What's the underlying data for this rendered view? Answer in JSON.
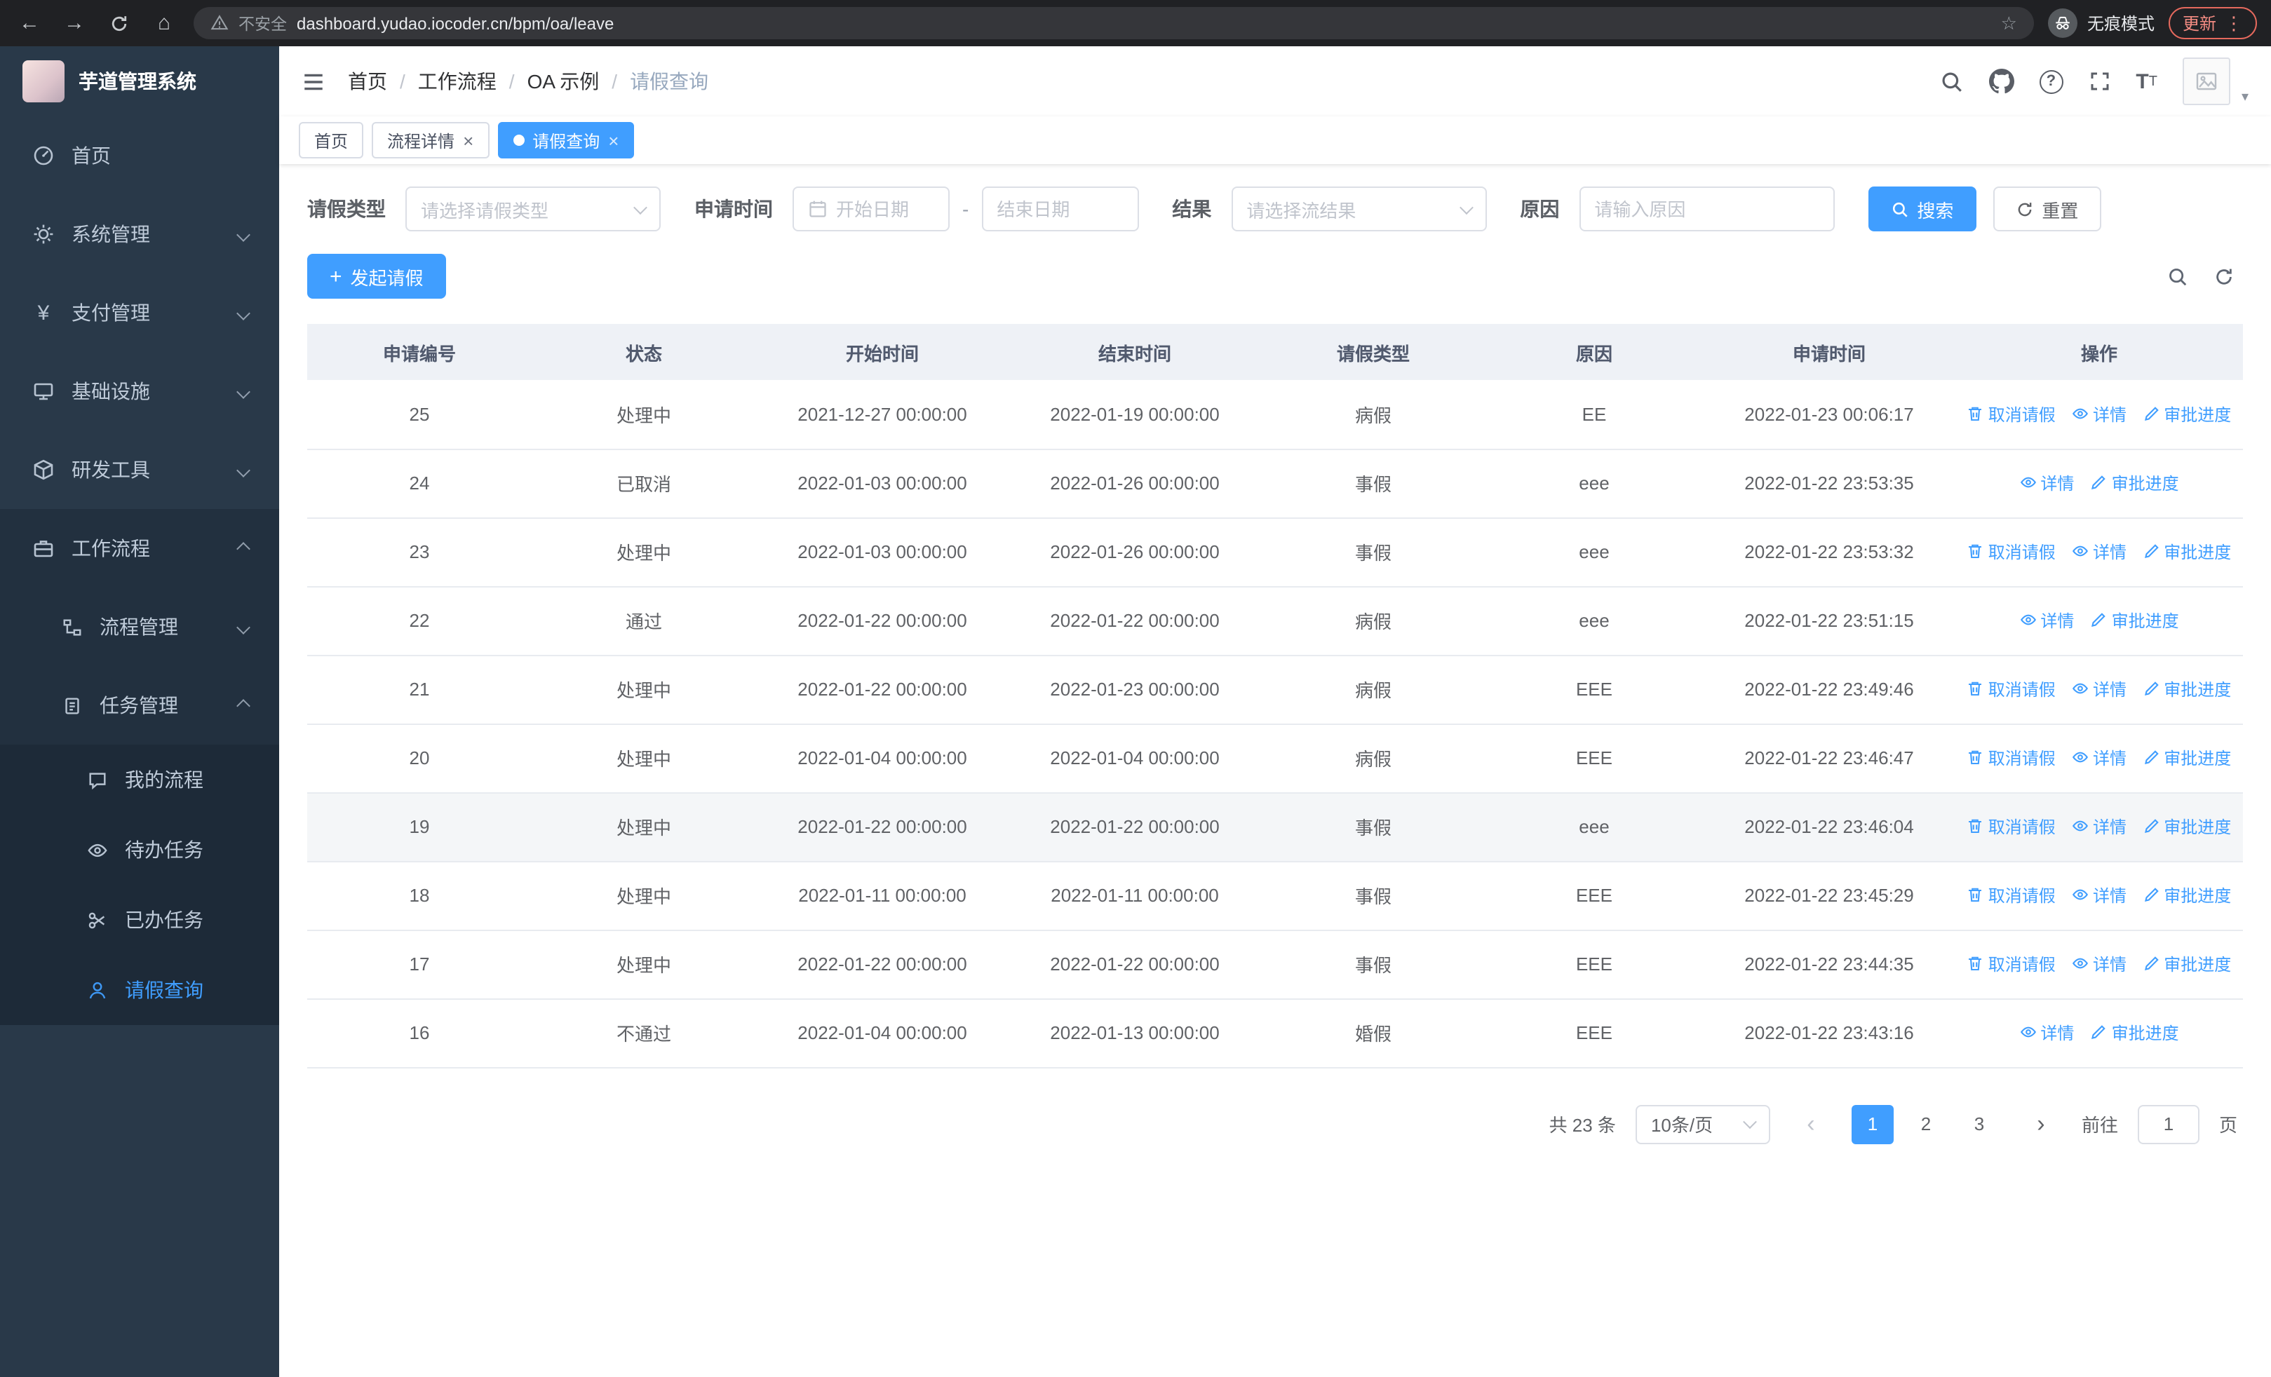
{
  "browser": {
    "security_label": "不安全",
    "url": "dashboard.yudao.iocoder.cn/bpm/oa/leave",
    "incognito_label": "无痕模式",
    "update_label": "更新"
  },
  "sidebar": {
    "app_title": "芋道管理系统",
    "items": [
      {
        "label": "首页"
      },
      {
        "label": "系统管理"
      },
      {
        "label": "支付管理"
      },
      {
        "label": "基础设施"
      },
      {
        "label": "研发工具"
      },
      {
        "label": "工作流程"
      },
      {
        "label": "流程管理"
      },
      {
        "label": "任务管理"
      },
      {
        "label": "我的流程"
      },
      {
        "label": "待办任务"
      },
      {
        "label": "已办任务"
      },
      {
        "label": "请假查询"
      }
    ]
  },
  "breadcrumb": {
    "items": [
      "首页",
      "工作流程",
      "OA 示例",
      "请假查询"
    ]
  },
  "tabs": [
    {
      "label": "首页"
    },
    {
      "label": "流程详情"
    },
    {
      "label": "请假查询"
    }
  ],
  "filters": {
    "type_label": "请假类型",
    "type_placeholder": "请选择请假类型",
    "time_label": "申请时间",
    "start_placeholder": "开始日期",
    "separator": "-",
    "end_placeholder": "结束日期",
    "result_label": "结果",
    "result_placeholder": "请选择流结果",
    "reason_label": "原因",
    "reason_placeholder": "请输入原因",
    "search_label": "搜索",
    "reset_label": "重置"
  },
  "toolbar": {
    "create_label": "发起请假"
  },
  "table": {
    "columns": [
      "申请编号",
      "状态",
      "开始时间",
      "结束时间",
      "请假类型",
      "原因",
      "申请时间",
      "操作"
    ],
    "action_labels": {
      "cancel": "取消请假",
      "detail": "详情",
      "progress": "审批进度"
    },
    "rows": [
      {
        "id": "25",
        "status": "处理中",
        "start": "2021-12-27 00:00:00",
        "end": "2022-01-19 00:00:00",
        "type": "病假",
        "reason": "EE",
        "applied": "2022-01-23 00:06:17",
        "cancel": true
      },
      {
        "id": "24",
        "status": "已取消",
        "start": "2022-01-03 00:00:00",
        "end": "2022-01-26 00:00:00",
        "type": "事假",
        "reason": "eee",
        "applied": "2022-01-22 23:53:35",
        "cancel": false
      },
      {
        "id": "23",
        "status": "处理中",
        "start": "2022-01-03 00:00:00",
        "end": "2022-01-26 00:00:00",
        "type": "事假",
        "reason": "eee",
        "applied": "2022-01-22 23:53:32",
        "cancel": true
      },
      {
        "id": "22",
        "status": "通过",
        "start": "2022-01-22 00:00:00",
        "end": "2022-01-22 00:00:00",
        "type": "病假",
        "reason": "eee",
        "applied": "2022-01-22 23:51:15",
        "cancel": false
      },
      {
        "id": "21",
        "status": "处理中",
        "start": "2022-01-22 00:00:00",
        "end": "2022-01-23 00:00:00",
        "type": "病假",
        "reason": "EEE",
        "applied": "2022-01-22 23:49:46",
        "cancel": true
      },
      {
        "id": "20",
        "status": "处理中",
        "start": "2022-01-04 00:00:00",
        "end": "2022-01-04 00:00:00",
        "type": "病假",
        "reason": "EEE",
        "applied": "2022-01-22 23:46:47",
        "cancel": true
      },
      {
        "id": "19",
        "status": "处理中",
        "start": "2022-01-22 00:00:00",
        "end": "2022-01-22 00:00:00",
        "type": "事假",
        "reason": "eee",
        "applied": "2022-01-22 23:46:04",
        "cancel": true,
        "highlighted": true
      },
      {
        "id": "18",
        "status": "处理中",
        "start": "2022-01-11 00:00:00",
        "end": "2022-01-11 00:00:00",
        "type": "事假",
        "reason": "EEE",
        "applied": "2022-01-22 23:45:29",
        "cancel": true
      },
      {
        "id": "17",
        "status": "处理中",
        "start": "2022-01-22 00:00:00",
        "end": "2022-01-22 00:00:00",
        "type": "事假",
        "reason": "EEE",
        "applied": "2022-01-22 23:44:35",
        "cancel": true
      },
      {
        "id": "16",
        "status": "不通过",
        "start": "2022-01-04 00:00:00",
        "end": "2022-01-13 00:00:00",
        "type": "婚假",
        "reason": "EEE",
        "applied": "2022-01-22 23:43:16",
        "cancel": false
      }
    ]
  },
  "pagination": {
    "total_label": "共 23 条",
    "page_size": "10条/页",
    "pages": [
      "1",
      "2",
      "3"
    ],
    "current": "1",
    "goto_label": "前往",
    "goto_value": "1",
    "unit_label": "页"
  },
  "colors": {
    "accent": "#409eff",
    "sidebar_bg": "#293949",
    "active_text": "#409eff"
  }
}
